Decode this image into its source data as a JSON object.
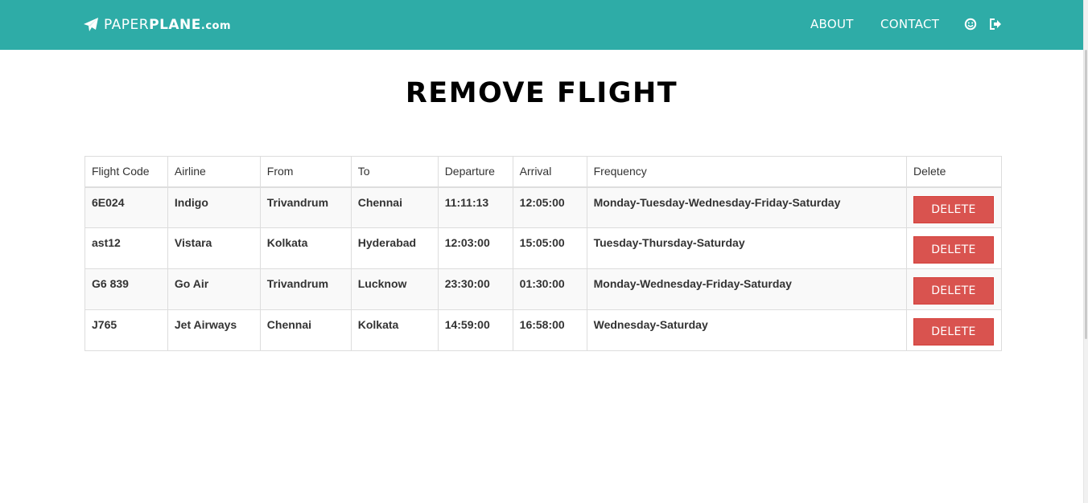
{
  "navbar": {
    "brand_light": "PAPER",
    "brand_bold": "PLANE",
    "brand_suffix": ".com",
    "brand_icon": "paper-plane-icon",
    "links": [
      {
        "label": "ABOUT"
      },
      {
        "label": "CONTACT"
      }
    ],
    "icons": [
      "smile-icon",
      "logout-icon"
    ],
    "color": "#2eaca7"
  },
  "page": {
    "title": "REMOVE FLIGHT"
  },
  "table": {
    "headers": [
      "Flight Code",
      "Airline",
      "From",
      "To",
      "Departure",
      "Arrival",
      "Frequency",
      "Delete"
    ],
    "rows": [
      {
        "code": "6E024",
        "airline": "Indigo",
        "from": "Trivandrum",
        "to": "Chennai",
        "departure": "11:11:13",
        "arrival": "12:05:00",
        "frequency": "Monday-Tuesday-Wednesday-Friday-Saturday",
        "action": "DELETE"
      },
      {
        "code": "ast12",
        "airline": "Vistara",
        "from": "Kolkata",
        "to": "Hyderabad",
        "departure": "12:03:00",
        "arrival": "15:05:00",
        "frequency": "Tuesday-Thursday-Saturday",
        "action": "DELETE"
      },
      {
        "code": "G6 839",
        "airline": "Go Air",
        "from": "Trivandrum",
        "to": "Lucknow",
        "departure": "23:30:00",
        "arrival": "01:30:00",
        "frequency": "Monday-Wednesday-Friday-Saturday",
        "action": "DELETE"
      },
      {
        "code": "J765",
        "airline": "Jet Airways",
        "from": "Chennai",
        "to": "Kolkata",
        "departure": "14:59:00",
        "arrival": "16:58:00",
        "frequency": "Wednesday-Saturday",
        "action": "DELETE"
      }
    ],
    "delete_button_color": "#d9534f"
  }
}
